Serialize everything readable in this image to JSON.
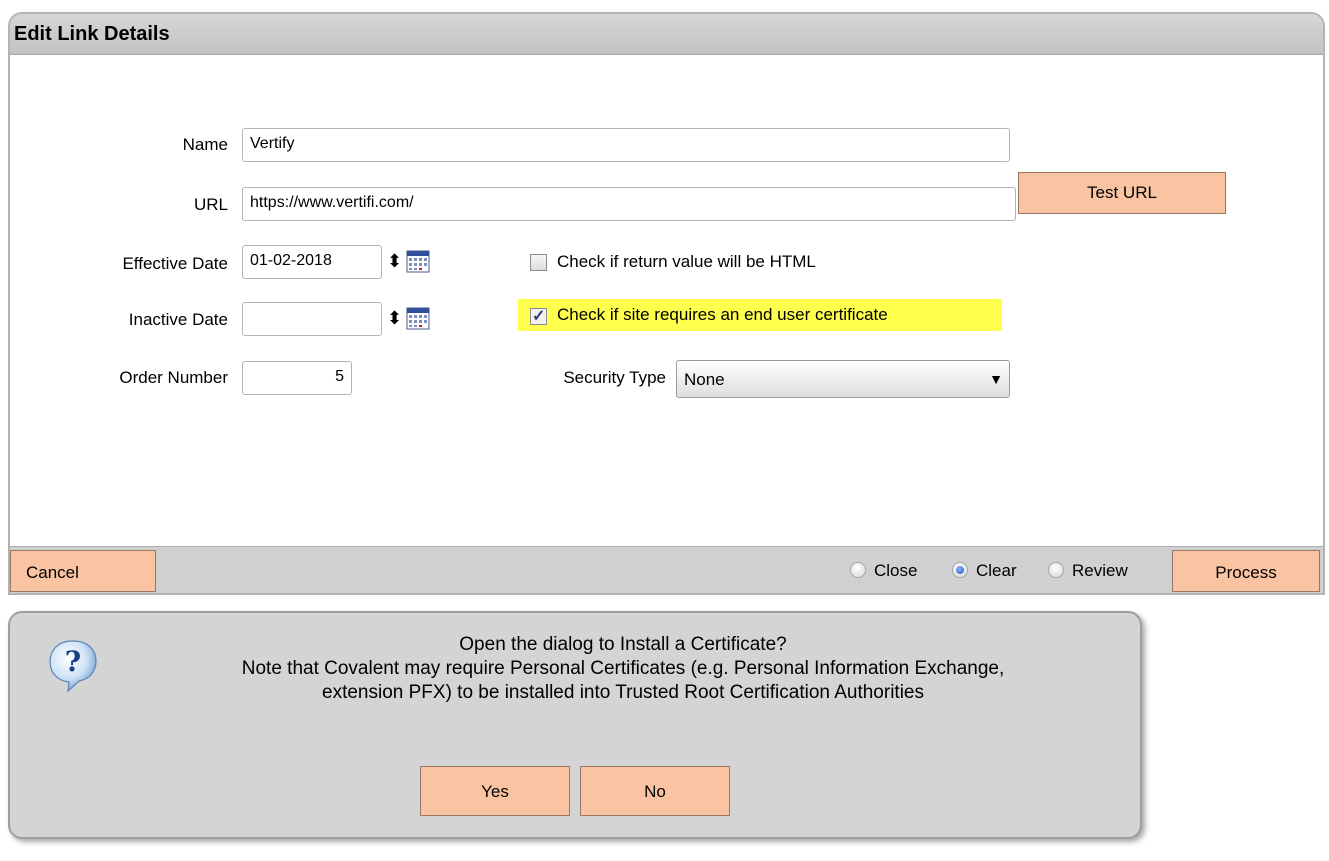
{
  "panel": {
    "title": "Edit Link Details",
    "labels": {
      "name": "Name",
      "url": "URL",
      "effective_date": "Effective Date",
      "inactive_date": "Inactive Date",
      "order_number": "Order Number",
      "security_type": "Security Type"
    },
    "fields": {
      "name": "Vertify",
      "url": "https://www.vertifi.com/",
      "effective_date": "01-02-2018",
      "inactive_date": "",
      "order_number": "5",
      "security_type": "None"
    },
    "test_url_label": "Test URL",
    "checkboxes": [
      {
        "label": "Check if return value will be HTML",
        "checked": false
      },
      {
        "label": "Check if site requires an end user certificate",
        "checked": true,
        "highlight": "#ffff4d"
      }
    ]
  },
  "footer": {
    "cancel_label": "Cancel",
    "process_label": "Process",
    "radios": [
      {
        "label": "Close",
        "selected": false
      },
      {
        "label": "Clear",
        "selected": true
      },
      {
        "label": "Review",
        "selected": false
      }
    ]
  },
  "dialog": {
    "icon": "question-icon",
    "line1": "Open the dialog to Install a Certificate?",
    "line2": "Note that Covalent may require Personal Certificates (e.g. Personal Information Exchange,",
    "line3": "extension PFX) to be installed into Trusted Root Certification Authorities",
    "yes_label": "Yes",
    "no_label": "No"
  },
  "colors": {
    "button": "#fac4a2",
    "header": "#c8c8c8",
    "highlight": "#ffff4d"
  }
}
